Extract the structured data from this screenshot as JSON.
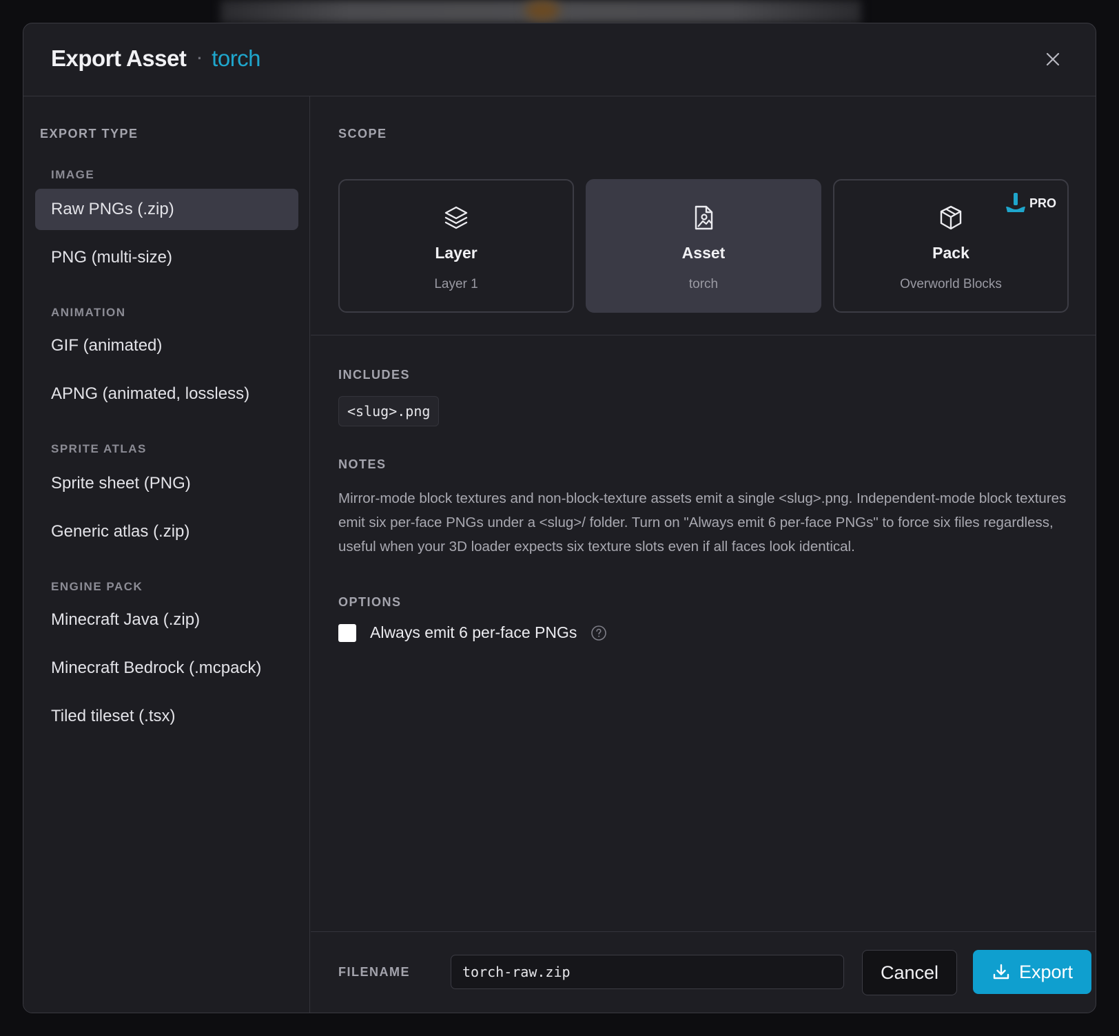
{
  "header": {
    "title": "Export Asset",
    "separator": "·",
    "asset_name": "torch"
  },
  "sidebar": {
    "section_label": "EXPORT TYPE",
    "groups": [
      {
        "label": "IMAGE",
        "items": [
          {
            "label": "Raw PNGs (.zip)",
            "active": true
          },
          {
            "label": "PNG (multi-size)"
          }
        ]
      },
      {
        "label": "ANIMATION",
        "items": [
          {
            "label": "GIF (animated)"
          },
          {
            "label": "APNG (animated, lossless)"
          }
        ]
      },
      {
        "label": "SPRITE ATLAS",
        "items": [
          {
            "label": "Sprite sheet (PNG)"
          },
          {
            "label": "Generic atlas (.zip)"
          }
        ]
      },
      {
        "label": "ENGINE PACK",
        "items": [
          {
            "label": "Minecraft Java (.zip)"
          },
          {
            "label": "Minecraft Bedrock (.mcpack)"
          },
          {
            "label": "Tiled tileset (.tsx)"
          }
        ]
      }
    ]
  },
  "scope": {
    "label": "SCOPE",
    "cards": [
      {
        "title": "Layer",
        "subtitle": "Layer 1",
        "icon": "layers-icon",
        "selected": false
      },
      {
        "title": "Asset",
        "subtitle": "torch",
        "icon": "file-image-icon",
        "selected": true
      },
      {
        "title": "Pack",
        "subtitle": "Overworld Blocks",
        "icon": "box-icon",
        "selected": false,
        "badge": "PRO"
      }
    ]
  },
  "includes": {
    "label": "INCLUDES",
    "chip": "<slug>.png"
  },
  "notes": {
    "label": "NOTES",
    "text": "Mirror-mode block textures and non-block-texture assets emit a single <slug>.png. Independent-mode block textures emit six per-face PNGs under a <slug>/ folder. Turn on \"Always emit 6 per-face PNGs\" to force six files regardless, useful when your 3D loader expects six texture slots even if all faces look identical."
  },
  "options": {
    "label": "OPTIONS",
    "always_emit_label": "Always emit 6 per-face PNGs",
    "always_emit_checked": false
  },
  "footer": {
    "filename_label": "FILENAME",
    "filename_value": "torch-raw.zip",
    "cancel_label": "Cancel",
    "export_label": "Export"
  },
  "colors": {
    "accent": "#0f9fcf",
    "asset_name": "#1fa6cc",
    "background": "#1e1e23",
    "selected_card": "#3a3a45"
  }
}
